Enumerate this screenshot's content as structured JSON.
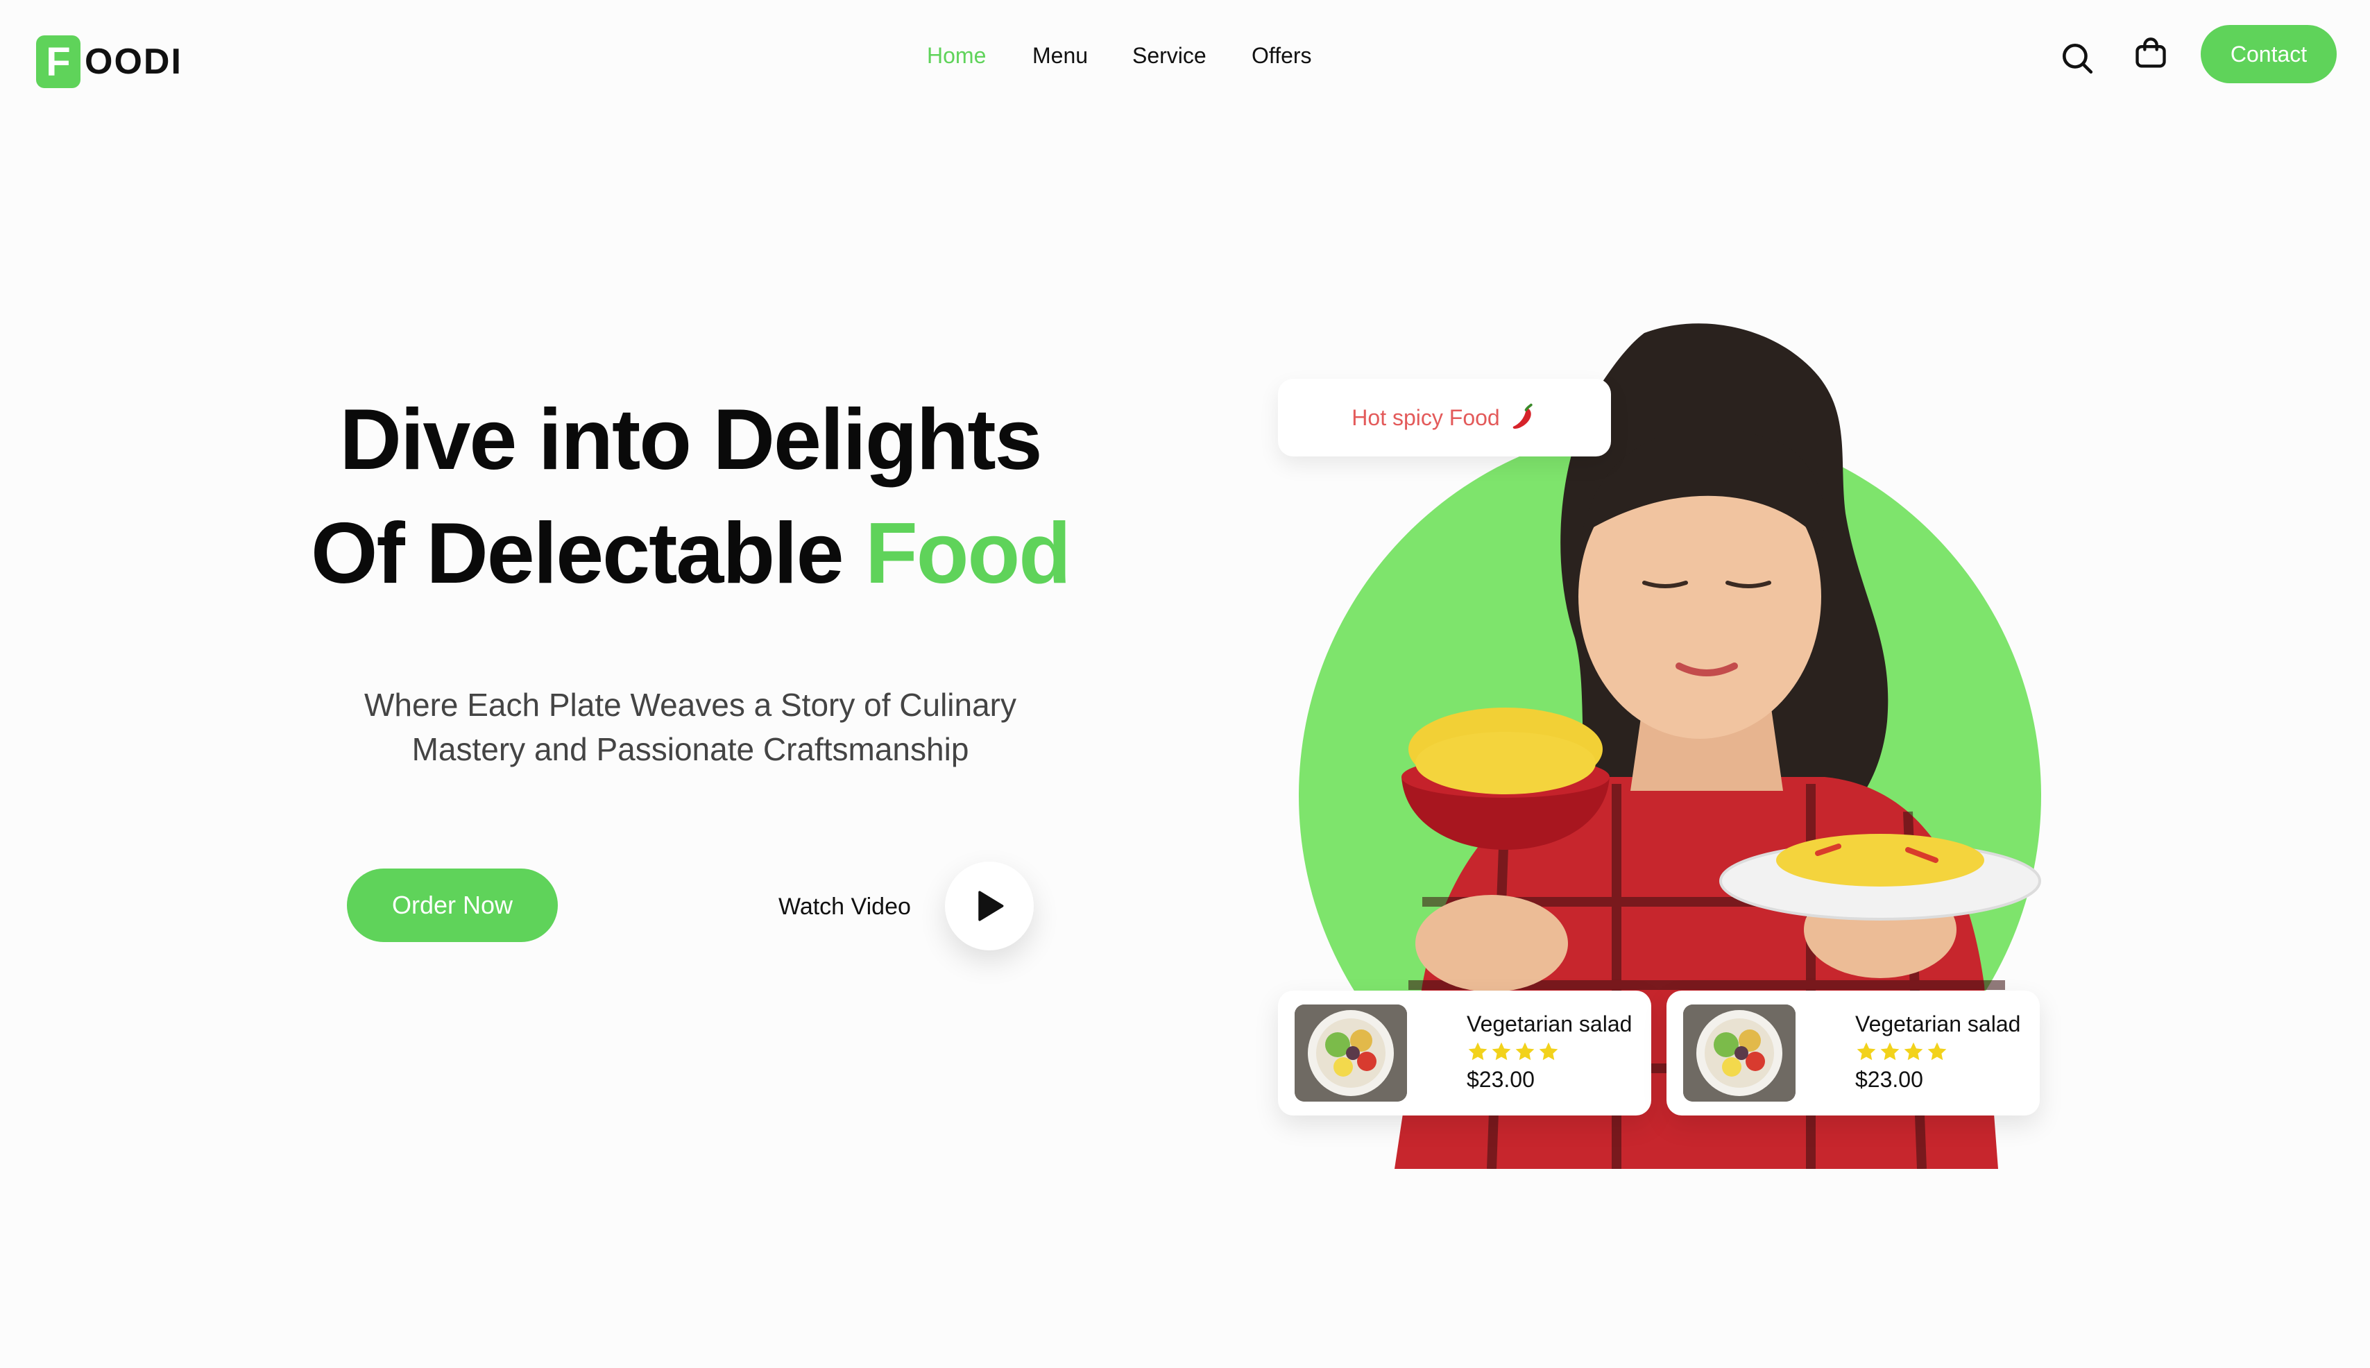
{
  "brand": {
    "badge_letter": "F",
    "name_rest": "OODI",
    "accent_color": "#5fd35a"
  },
  "nav": {
    "items": [
      {
        "label": "Home",
        "active": true
      },
      {
        "label": "Menu",
        "active": false
      },
      {
        "label": "Service",
        "active": false
      },
      {
        "label": "Offers",
        "active": false
      }
    ]
  },
  "header": {
    "search_icon": "search-icon",
    "cart_icon": "shopping-bag-icon",
    "contact_label": "Contact"
  },
  "hero": {
    "title_line1": "Dive into Delights",
    "title_line2_prefix": "Of Delectable ",
    "title_line2_accent": "Food",
    "subtitle_line1": "Where Each Plate Weaves a Story of Culinary",
    "subtitle_line2": "Mastery and Passionate Craftsmanship",
    "order_label": "Order Now",
    "watch_label": "Watch Video",
    "play_icon": "play-icon"
  },
  "badge": {
    "text": "Hot spicy Food",
    "icon": "chili-pepper-icon"
  },
  "food_cards": [
    {
      "name": "Vegetarian salad",
      "rating": 4,
      "price": "$23.00"
    },
    {
      "name": "Vegetarian salad",
      "rating": 4,
      "price": "$23.00"
    }
  ],
  "colors": {
    "accent": "#5fd35a",
    "hero_circle": "#7ee46c",
    "spicy_text": "#e35a5a",
    "star": "#f2d21b"
  }
}
